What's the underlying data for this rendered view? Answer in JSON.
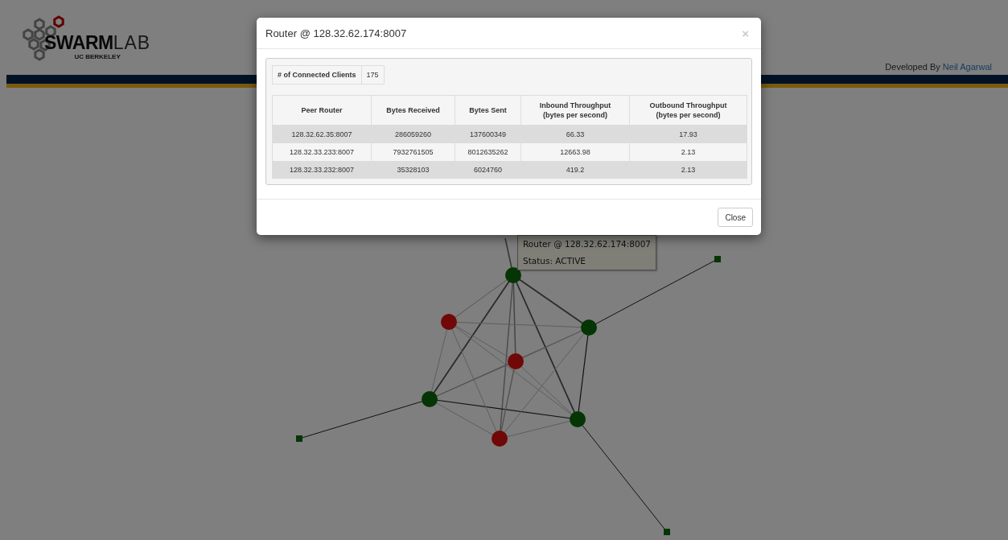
{
  "header": {
    "logo": {
      "wordmark_bold": "SWARM",
      "wordmark_light": "LAB",
      "subtitle": "UC BERKELEY"
    },
    "credit": "Developed By",
    "author_link": "Neil Agarwal"
  },
  "graph": {
    "nodes": [
      {
        "kind": "router",
        "active": true
      },
      {
        "kind": "router",
        "active": true
      },
      {
        "kind": "router",
        "active": true
      },
      {
        "kind": "router",
        "active": true
      },
      {
        "kind": "router",
        "active": false
      },
      {
        "kind": "router",
        "active": false
      },
      {
        "kind": "router",
        "active": false
      },
      {
        "kind": "client"
      },
      {
        "kind": "client"
      },
      {
        "kind": "client"
      }
    ],
    "tooltip": {
      "title": "Router @ 128.32.62.174:8007",
      "status": "Status: ACTIVE"
    }
  },
  "modal": {
    "title": "Router @ 128.32.62.174:8007",
    "close_icon": "×",
    "clients_label": "# of Connected Clients",
    "clients_value": "175",
    "table": {
      "columns": [
        "Peer Router",
        "Bytes Received",
        "Bytes Sent",
        "Inbound Throughput\n(bytes per second)",
        "Outbound Throughput\n(bytes per second)"
      ],
      "rows": [
        [
          "128.32.62.35:8007",
          "286059260",
          "137600349",
          "66.33",
          "17.93"
        ],
        [
          "128.32.33.233:8007",
          "7932761505",
          "8012635262",
          "12663.98",
          "2.13"
        ],
        [
          "128.32.33.232:8007",
          "35328103",
          "6024760",
          "419.2",
          "2.13"
        ]
      ]
    },
    "close_button": "Close"
  }
}
